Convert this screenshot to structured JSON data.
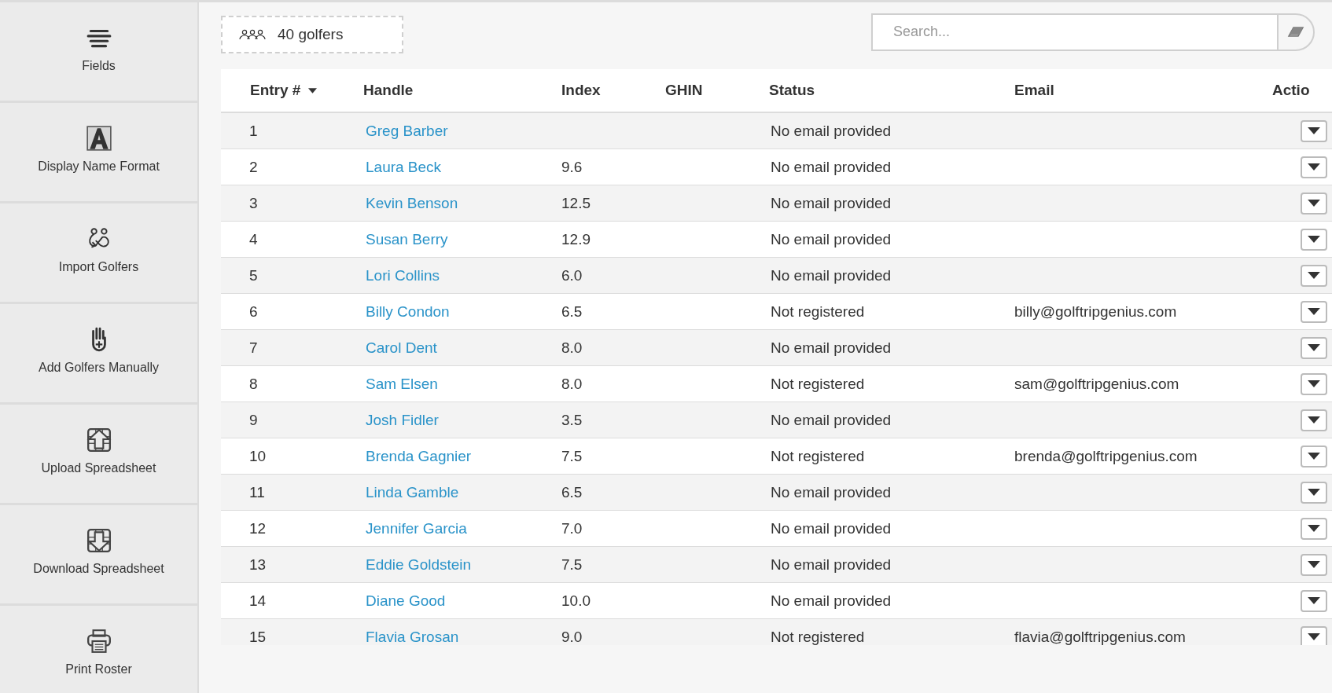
{
  "sidebar": {
    "items": [
      {
        "label": "Fields"
      },
      {
        "label": "Display Name Format"
      },
      {
        "label": "Import Golfers"
      },
      {
        "label": "Add Golfers Manually"
      },
      {
        "label": "Upload Spreadsheet"
      },
      {
        "label": "Download Spreadsheet"
      },
      {
        "label": "Print Roster"
      }
    ]
  },
  "golfer_count": "40 golfers",
  "search": {
    "placeholder": "Search..."
  },
  "table": {
    "columns": [
      {
        "label": "Entry #",
        "sorted": true
      },
      {
        "label": "Handle",
        "sorted": false
      },
      {
        "label": "Index",
        "sorted": false
      },
      {
        "label": "GHIN",
        "sorted": false
      },
      {
        "label": "Status",
        "sorted": false
      },
      {
        "label": "Email",
        "sorted": false
      },
      {
        "label": "Actio",
        "sorted": false
      }
    ],
    "rows": [
      {
        "entry": "1",
        "handle": "Greg Barber",
        "status": "No email provided"
      },
      {
        "entry": "2",
        "handle": "Laura Beck",
        "index": "9.6",
        "status": "No email provided"
      },
      {
        "entry": "3",
        "handle": "Kevin Benson",
        "index": "12.5",
        "status": "No email provided"
      },
      {
        "entry": "4",
        "handle": "Susan Berry",
        "index": "12.9",
        "status": "No email provided"
      },
      {
        "entry": "5",
        "handle": "Lori Collins",
        "index": "6.0",
        "status": "No email provided"
      },
      {
        "entry": "6",
        "handle": "Billy Condon",
        "index": "6.5",
        "status": "Not registered",
        "email": "billy@golftripgenius.com"
      },
      {
        "entry": "7",
        "handle": "Carol Dent",
        "index": "8.0",
        "status": "No email provided"
      },
      {
        "entry": "8",
        "handle": "Sam Elsen",
        "index": "8.0",
        "status": "Not registered",
        "email": "sam@golftripgenius.com"
      },
      {
        "entry": "9",
        "handle": "Josh Fidler",
        "index": "3.5",
        "status": "No email provided"
      },
      {
        "entry": "10",
        "handle": "Brenda Gagnier",
        "index": "7.5",
        "status": "Not registered",
        "email": "brenda@golftripgenius.com"
      },
      {
        "entry": "11",
        "handle": "Linda Gamble",
        "index": "6.5",
        "status": "No email provided"
      },
      {
        "entry": "12",
        "handle": "Jennifer Garcia",
        "index": "7.0",
        "status": "No email provided"
      },
      {
        "entry": "13",
        "handle": "Eddie Goldstein",
        "index": "7.5",
        "status": "No email provided"
      },
      {
        "entry": "14",
        "handle": "Diane Good",
        "index": "10.0",
        "status": "No email provided"
      },
      {
        "entry": "15",
        "handle": "Flavia Grosan",
        "index": "9.0",
        "status": "Not registered",
        "email": "flavia@golftripgenius.com"
      }
    ]
  }
}
